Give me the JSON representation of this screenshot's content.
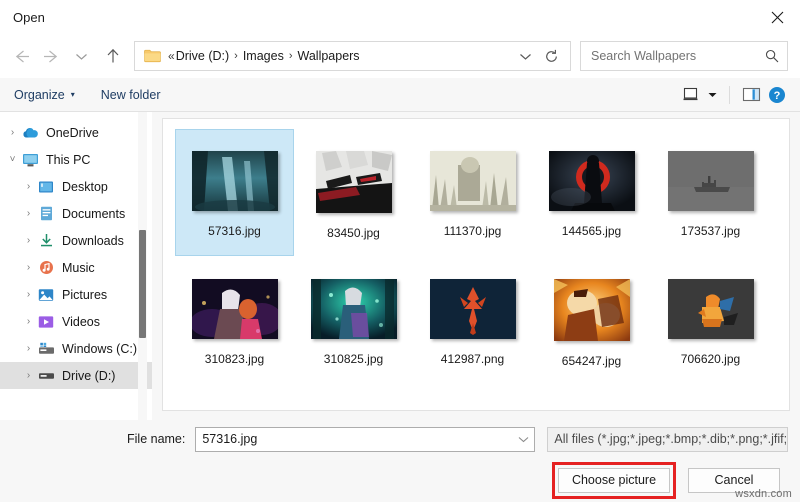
{
  "window": {
    "title": "Open",
    "close_label": "Close",
    "close_icon": "close-icon"
  },
  "nav": {
    "back_label": "Back",
    "forward_label": "Forward",
    "recent_label": "Recent locations",
    "up_label": "Up",
    "folder_icon": "folder-icon",
    "overflow": "«",
    "separator": "›",
    "breadcrumbs": [
      "Drive (D:)",
      "Images",
      "Wallpapers"
    ],
    "dropdown_label": "Previous locations",
    "refresh_label": "Refresh"
  },
  "search": {
    "placeholder": "Search Wallpapers",
    "value": "",
    "icon": "search-icon"
  },
  "commandbar": {
    "organize_label": "Organize",
    "organize_caret": "▾",
    "new_folder_label": "New folder",
    "view_icon": "view-layout-icon",
    "view_caret": "▾",
    "preview_pane_icon": "preview-pane-icon",
    "help_icon": "help-icon"
  },
  "sidebar": {
    "items": [
      {
        "label": "OneDrive",
        "icon": "cloud-icon",
        "depth": 1,
        "expanded": false,
        "selected": false
      },
      {
        "label": "This PC",
        "icon": "computer-icon",
        "depth": 1,
        "expanded": true,
        "selected": false
      },
      {
        "label": "Desktop",
        "icon": "desktop-icon",
        "depth": 2,
        "expanded": false,
        "selected": false
      },
      {
        "label": "Documents",
        "icon": "documents-icon",
        "depth": 2,
        "expanded": false,
        "selected": false
      },
      {
        "label": "Downloads",
        "icon": "downloads-icon",
        "depth": 2,
        "expanded": false,
        "selected": false
      },
      {
        "label": "Music",
        "icon": "music-icon",
        "depth": 2,
        "expanded": false,
        "selected": false
      },
      {
        "label": "Pictures",
        "icon": "pictures-icon",
        "depth": 2,
        "expanded": false,
        "selected": false
      },
      {
        "label": "Videos",
        "icon": "videos-icon",
        "depth": 2,
        "expanded": false,
        "selected": false
      },
      {
        "label": "Windows (C:)",
        "icon": "drive-system-icon",
        "depth": 2,
        "expanded": false,
        "selected": false
      },
      {
        "label": "Drive (D:)",
        "icon": "drive-icon",
        "depth": 2,
        "expanded": false,
        "selected": true
      }
    ]
  },
  "files": [
    {
      "name": "57316.jpg",
      "selected": true,
      "thumb": "forest-waterfall"
    },
    {
      "name": "83450.jpg",
      "selected": false,
      "thumb": "anime-white-hair"
    },
    {
      "name": "111370.jpg",
      "selected": false,
      "thumb": "sepia-reeds"
    },
    {
      "name": "144565.jpg",
      "selected": false,
      "thumb": "red-moon-figure"
    },
    {
      "name": "173537.jpg",
      "selected": false,
      "thumb": "grey-ship"
    },
    {
      "name": "310823.jpg",
      "selected": false,
      "thumb": "anime-couple-kiss"
    },
    {
      "name": "310825.jpg",
      "selected": false,
      "thumb": "teal-forest-girl"
    },
    {
      "name": "412987.png",
      "selected": false,
      "thumb": "skyrim-emblem"
    },
    {
      "name": "654247.jpg",
      "selected": false,
      "thumb": "orange-action"
    },
    {
      "name": "706620.jpg",
      "selected": false,
      "thumb": "charizard-grey"
    }
  ],
  "bottom": {
    "filename_label": "File name:",
    "filename_value": "57316.jpg",
    "filename_dropdown_icon": "chevron-down-icon",
    "filter_value": "All files (*.jpg;*.jpeg;*.bmp;*.dib;*.png;*.jfif;*.",
    "choose_label": "Choose picture",
    "cancel_label": "Cancel"
  },
  "annotation": {
    "highlight_color": "#e52121",
    "watermark": "wsxdn.com"
  }
}
